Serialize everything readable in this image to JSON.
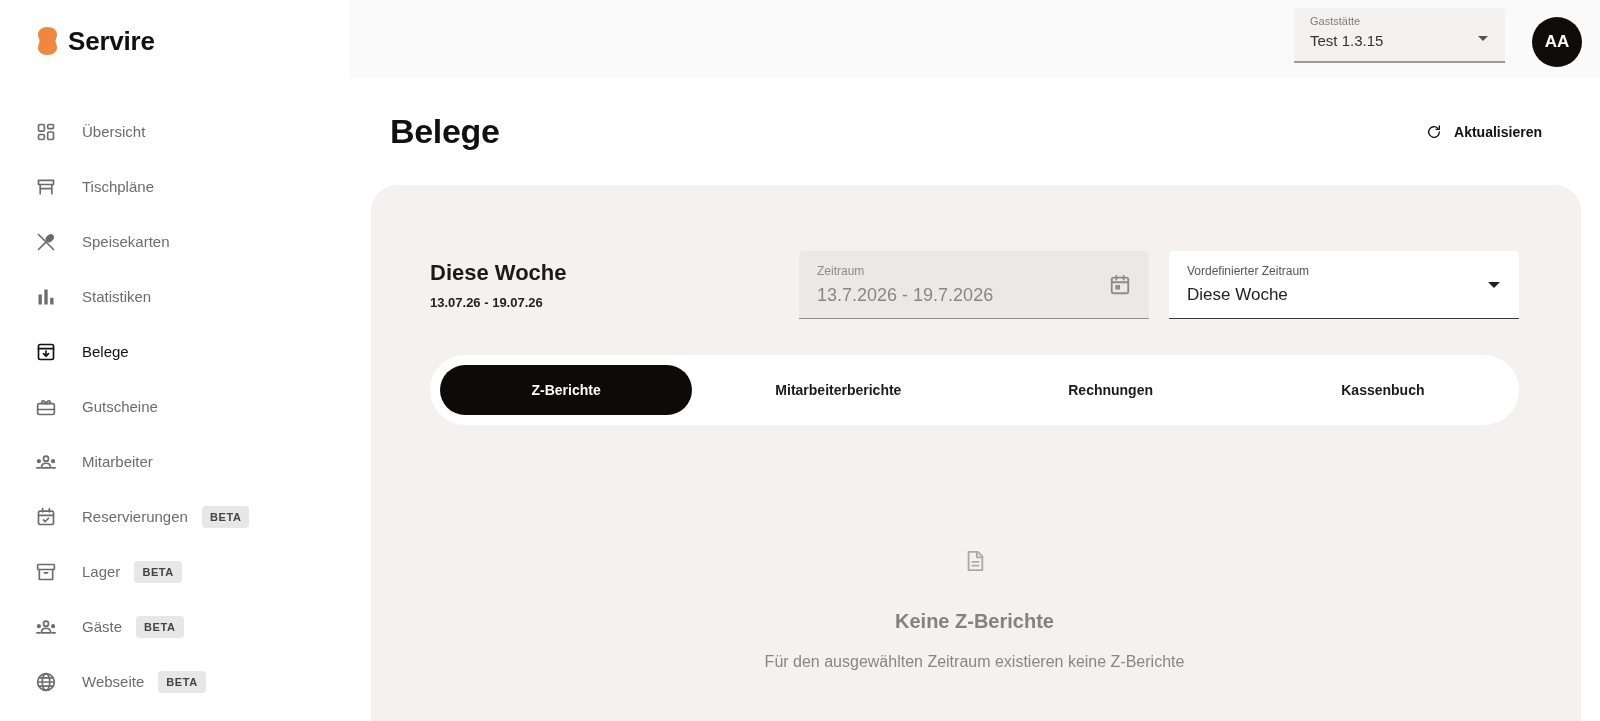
{
  "brand": {
    "name": "Servire"
  },
  "header": {
    "venue_select": {
      "label": "Gaststätte",
      "value": "Test 1.3.15"
    },
    "avatar": {
      "initials": "AA"
    }
  },
  "sidebar": {
    "items": [
      {
        "label": "Übersicht",
        "selected": false
      },
      {
        "label": "Tischpläne",
        "selected": false
      },
      {
        "label": "Speisekarten",
        "selected": false
      },
      {
        "label": "Statistiken",
        "selected": false
      },
      {
        "label": "Belege",
        "selected": true
      },
      {
        "label": "Gutscheine",
        "selected": false
      },
      {
        "label": "Mitarbeiter",
        "selected": false
      },
      {
        "label": "Reservierungen",
        "badge": "BETA",
        "selected": false
      },
      {
        "label": "Lager",
        "badge": "BETA",
        "selected": false
      },
      {
        "label": "Gäste",
        "badge": "BETA",
        "selected": false
      },
      {
        "label": "Webseite",
        "badge": "BETA",
        "selected": false
      }
    ]
  },
  "page": {
    "title": "Belege",
    "refresh_button": "Aktualisieren"
  },
  "panel": {
    "period": {
      "title": "Diese Woche",
      "range": "13.07.26 - 19.07.26"
    },
    "date_field": {
      "label": "Zeitraum",
      "value": "13.7.2026 - 19.7.2026",
      "disabled": true
    },
    "preset_select": {
      "label": "Vordefinierter Zeitraum",
      "value": "Diese Woche"
    },
    "tabs": [
      {
        "label": "Z-Berichte",
        "selected": true
      },
      {
        "label": "Mitarbeiterberichte",
        "selected": false
      },
      {
        "label": "Rechnungen",
        "selected": false
      },
      {
        "label": "Kassenbuch",
        "selected": false
      }
    ],
    "empty_state": {
      "title": "Keine Z-Berichte",
      "message": "Für den ausgewählten Zeitraum existieren keine Z-Berichte"
    }
  }
}
